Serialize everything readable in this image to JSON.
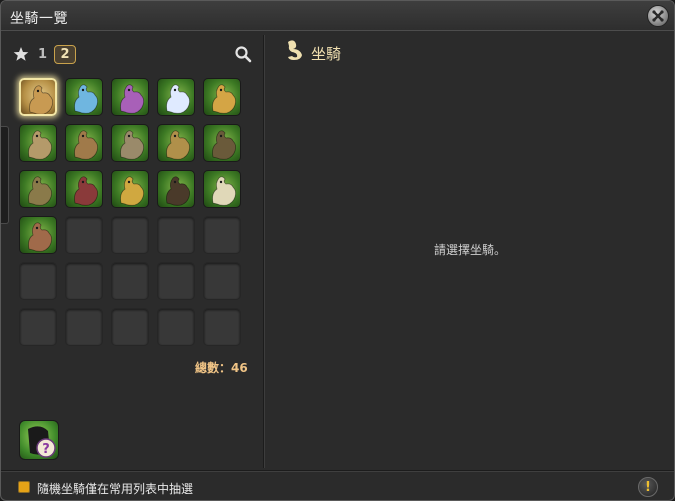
{
  "window": {
    "title": "坐騎一覽"
  },
  "toolbar": {
    "page_1": "1",
    "page_2": "2"
  },
  "mounts": [
    {
      "name": "mount-1",
      "selected": true,
      "color": "#c89a52",
      "bg": "#c8a466"
    },
    {
      "name": "mount-2",
      "selected": false,
      "color": "#6fb6e0",
      "bg": "#4a8a30"
    },
    {
      "name": "mount-3",
      "selected": false,
      "color": "#a860b8",
      "bg": "#4a8a30"
    },
    {
      "name": "mount-4",
      "selected": false,
      "color": "#dfeaff",
      "bg": "#4a8a30"
    },
    {
      "name": "mount-5",
      "selected": false,
      "color": "#d4a545",
      "bg": "#4a8a30"
    },
    {
      "name": "mount-6",
      "selected": false,
      "color": "#b49a6a",
      "bg": "#4a8a30"
    },
    {
      "name": "mount-7",
      "selected": false,
      "color": "#a07a4a",
      "bg": "#4a8a30"
    },
    {
      "name": "mount-8",
      "selected": false,
      "color": "#9a8a6a",
      "bg": "#4a8a30"
    },
    {
      "name": "mount-9",
      "selected": false,
      "color": "#b0904a",
      "bg": "#4a8a30"
    },
    {
      "name": "mount-10",
      "selected": false,
      "color": "#6a5a3a",
      "bg": "#4a8a30"
    },
    {
      "name": "mount-11",
      "selected": false,
      "color": "#8a7a4a",
      "bg": "#4a8a30"
    },
    {
      "name": "mount-12",
      "selected": false,
      "color": "#8a3a3a",
      "bg": "#4a8a30"
    },
    {
      "name": "mount-13",
      "selected": false,
      "color": "#d0a840",
      "bg": "#4a8a30"
    },
    {
      "name": "mount-14",
      "selected": false,
      "color": "#4a3a2a",
      "bg": "#4a8a30"
    },
    {
      "name": "mount-15",
      "selected": false,
      "color": "#e0d8b8",
      "bg": "#4a8a30"
    },
    {
      "name": "mount-16",
      "selected": false,
      "color": "#a06a4a",
      "bg": "#4a8a30"
    }
  ],
  "total": {
    "label": "總數：46"
  },
  "detail": {
    "header": "坐騎",
    "empty_message": "請選擇坐騎。"
  },
  "footer": {
    "label": "隨機坐騎僅在常用列表中抽選"
  },
  "icons": {
    "close": "close-icon",
    "favorite": "star-icon",
    "search": "search-icon",
    "random": "random-mount-icon",
    "mount_header": "mount-icon",
    "info": "info-icon"
  }
}
